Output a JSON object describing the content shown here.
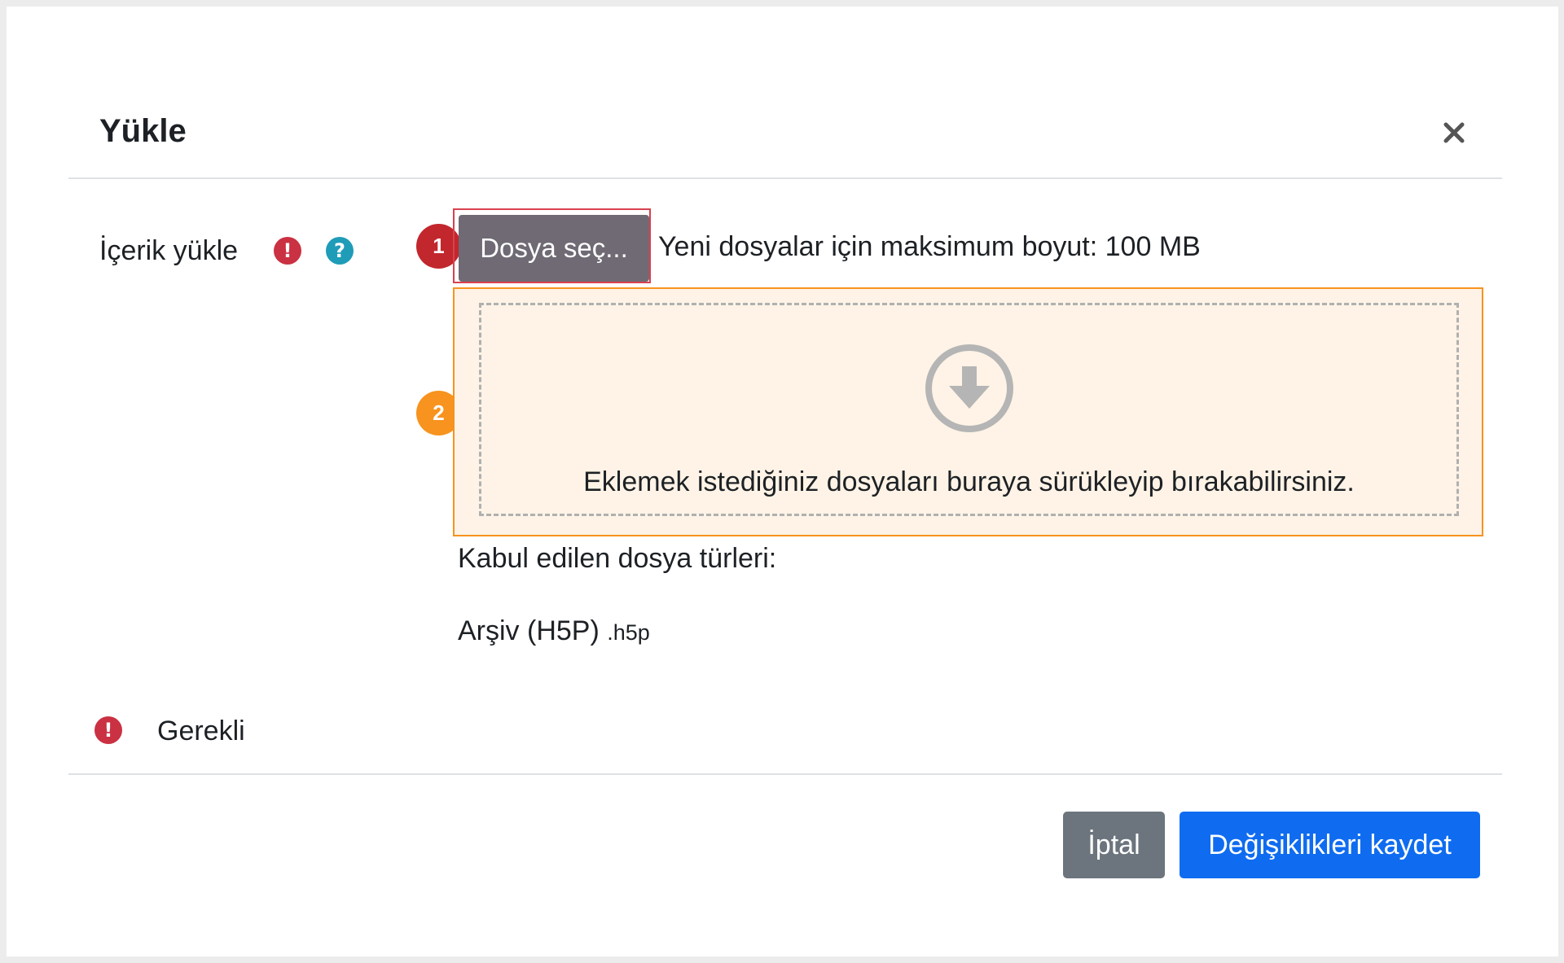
{
  "dialog": {
    "title": "Yükle"
  },
  "field": {
    "label": "İçerik yükle",
    "choose_button": "Dosya seç...",
    "max_size_text": "Yeni dosyalar için maksimum boyut: 100 MB"
  },
  "dropzone": {
    "text": "Eklemek istediğiniz dosyaları buraya sürükleyip bırakabilirsiniz."
  },
  "accepted": {
    "label": "Kabul edilen dosya türleri:",
    "type_name": "Arşiv (H5P)",
    "type_ext": ".h5p"
  },
  "required_note": "Gerekli",
  "footer": {
    "cancel_label": "İptal",
    "save_label": "Değişiklikleri kaydet"
  },
  "callouts": [
    "1",
    "2"
  ],
  "icons": {
    "required": "exclamation-circle-icon",
    "help": "question-circle-icon",
    "close": "close-icon",
    "drop": "download-arrow-icon"
  },
  "colors": {
    "required_red": "#ca3142",
    "help_teal": "#1f9cb7",
    "primary_blue": "#0f6cf0",
    "secondary_gray": "#6c757d",
    "callout_red": "#c1272d",
    "callout_orange": "#f7931e"
  }
}
